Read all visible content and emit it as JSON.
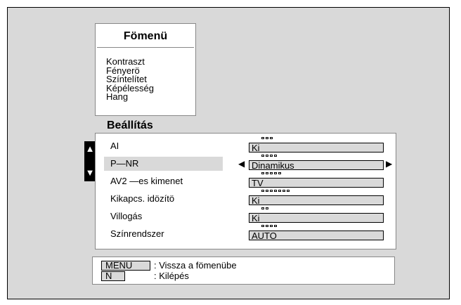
{
  "main_menu": {
    "title": "Fömenü",
    "items": [
      "Kontraszt",
      "Fényerö",
      "Színtelítet",
      "Képélesség",
      "Hang"
    ]
  },
  "submenu": {
    "title": "Beállítás",
    "rows": [
      {
        "label": "AI",
        "value": "Ki",
        "dots": 3,
        "selected": false
      },
      {
        "label": "P—NR",
        "value": "Dinamikus",
        "dots": 4,
        "selected": true
      },
      {
        "label": "AV2 —es kimenet",
        "value": "TV",
        "dots": 5,
        "selected": false
      },
      {
        "label": "Kikapcs. idözítö",
        "value": "Ki",
        "dots": 7,
        "selected": false
      },
      {
        "label": "Villogás",
        "value": "Ki",
        "dots": 2,
        "selected": false
      },
      {
        "label": "Színrendszer",
        "value": "AUTO",
        "dots": 4,
        "selected": false
      }
    ],
    "arrow_left": "◀",
    "arrow_right": "▶",
    "scroll_up": "▲",
    "scroll_down": "▼"
  },
  "help": {
    "menu_key": "MENU",
    "menu_desc": ": Vissza a fömenübe",
    "n_key": "N",
    "n_desc": ": Kilépés"
  }
}
